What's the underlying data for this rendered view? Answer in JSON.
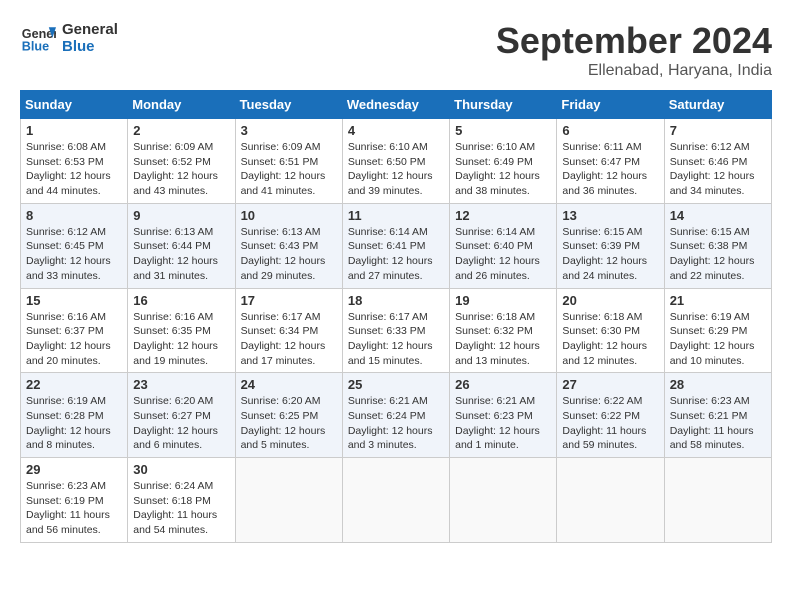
{
  "header": {
    "logo_line1": "General",
    "logo_line2": "Blue",
    "month_title": "September 2024",
    "location": "Ellenabad, Haryana, India"
  },
  "days_of_week": [
    "Sunday",
    "Monday",
    "Tuesday",
    "Wednesday",
    "Thursday",
    "Friday",
    "Saturday"
  ],
  "weeks": [
    [
      {
        "day": "1",
        "info": "Sunrise: 6:08 AM\nSunset: 6:53 PM\nDaylight: 12 hours\nand 44 minutes."
      },
      {
        "day": "2",
        "info": "Sunrise: 6:09 AM\nSunset: 6:52 PM\nDaylight: 12 hours\nand 43 minutes."
      },
      {
        "day": "3",
        "info": "Sunrise: 6:09 AM\nSunset: 6:51 PM\nDaylight: 12 hours\nand 41 minutes."
      },
      {
        "day": "4",
        "info": "Sunrise: 6:10 AM\nSunset: 6:50 PM\nDaylight: 12 hours\nand 39 minutes."
      },
      {
        "day": "5",
        "info": "Sunrise: 6:10 AM\nSunset: 6:49 PM\nDaylight: 12 hours\nand 38 minutes."
      },
      {
        "day": "6",
        "info": "Sunrise: 6:11 AM\nSunset: 6:47 PM\nDaylight: 12 hours\nand 36 minutes."
      },
      {
        "day": "7",
        "info": "Sunrise: 6:12 AM\nSunset: 6:46 PM\nDaylight: 12 hours\nand 34 minutes."
      }
    ],
    [
      {
        "day": "8",
        "info": "Sunrise: 6:12 AM\nSunset: 6:45 PM\nDaylight: 12 hours\nand 33 minutes."
      },
      {
        "day": "9",
        "info": "Sunrise: 6:13 AM\nSunset: 6:44 PM\nDaylight: 12 hours\nand 31 minutes."
      },
      {
        "day": "10",
        "info": "Sunrise: 6:13 AM\nSunset: 6:43 PM\nDaylight: 12 hours\nand 29 minutes."
      },
      {
        "day": "11",
        "info": "Sunrise: 6:14 AM\nSunset: 6:41 PM\nDaylight: 12 hours\nand 27 minutes."
      },
      {
        "day": "12",
        "info": "Sunrise: 6:14 AM\nSunset: 6:40 PM\nDaylight: 12 hours\nand 26 minutes."
      },
      {
        "day": "13",
        "info": "Sunrise: 6:15 AM\nSunset: 6:39 PM\nDaylight: 12 hours\nand 24 minutes."
      },
      {
        "day": "14",
        "info": "Sunrise: 6:15 AM\nSunset: 6:38 PM\nDaylight: 12 hours\nand 22 minutes."
      }
    ],
    [
      {
        "day": "15",
        "info": "Sunrise: 6:16 AM\nSunset: 6:37 PM\nDaylight: 12 hours\nand 20 minutes."
      },
      {
        "day": "16",
        "info": "Sunrise: 6:16 AM\nSunset: 6:35 PM\nDaylight: 12 hours\nand 19 minutes."
      },
      {
        "day": "17",
        "info": "Sunrise: 6:17 AM\nSunset: 6:34 PM\nDaylight: 12 hours\nand 17 minutes."
      },
      {
        "day": "18",
        "info": "Sunrise: 6:17 AM\nSunset: 6:33 PM\nDaylight: 12 hours\nand 15 minutes."
      },
      {
        "day": "19",
        "info": "Sunrise: 6:18 AM\nSunset: 6:32 PM\nDaylight: 12 hours\nand 13 minutes."
      },
      {
        "day": "20",
        "info": "Sunrise: 6:18 AM\nSunset: 6:30 PM\nDaylight: 12 hours\nand 12 minutes."
      },
      {
        "day": "21",
        "info": "Sunrise: 6:19 AM\nSunset: 6:29 PM\nDaylight: 12 hours\nand 10 minutes."
      }
    ],
    [
      {
        "day": "22",
        "info": "Sunrise: 6:19 AM\nSunset: 6:28 PM\nDaylight: 12 hours\nand 8 minutes."
      },
      {
        "day": "23",
        "info": "Sunrise: 6:20 AM\nSunset: 6:27 PM\nDaylight: 12 hours\nand 6 minutes."
      },
      {
        "day": "24",
        "info": "Sunrise: 6:20 AM\nSunset: 6:25 PM\nDaylight: 12 hours\nand 5 minutes."
      },
      {
        "day": "25",
        "info": "Sunrise: 6:21 AM\nSunset: 6:24 PM\nDaylight: 12 hours\nand 3 minutes."
      },
      {
        "day": "26",
        "info": "Sunrise: 6:21 AM\nSunset: 6:23 PM\nDaylight: 12 hours\nand 1 minute."
      },
      {
        "day": "27",
        "info": "Sunrise: 6:22 AM\nSunset: 6:22 PM\nDaylight: 11 hours\nand 59 minutes."
      },
      {
        "day": "28",
        "info": "Sunrise: 6:23 AM\nSunset: 6:21 PM\nDaylight: 11 hours\nand 58 minutes."
      }
    ],
    [
      {
        "day": "29",
        "info": "Sunrise: 6:23 AM\nSunset: 6:19 PM\nDaylight: 11 hours\nand 56 minutes."
      },
      {
        "day": "30",
        "info": "Sunrise: 6:24 AM\nSunset: 6:18 PM\nDaylight: 11 hours\nand 54 minutes."
      },
      {
        "day": "",
        "info": ""
      },
      {
        "day": "",
        "info": ""
      },
      {
        "day": "",
        "info": ""
      },
      {
        "day": "",
        "info": ""
      },
      {
        "day": "",
        "info": ""
      }
    ]
  ]
}
